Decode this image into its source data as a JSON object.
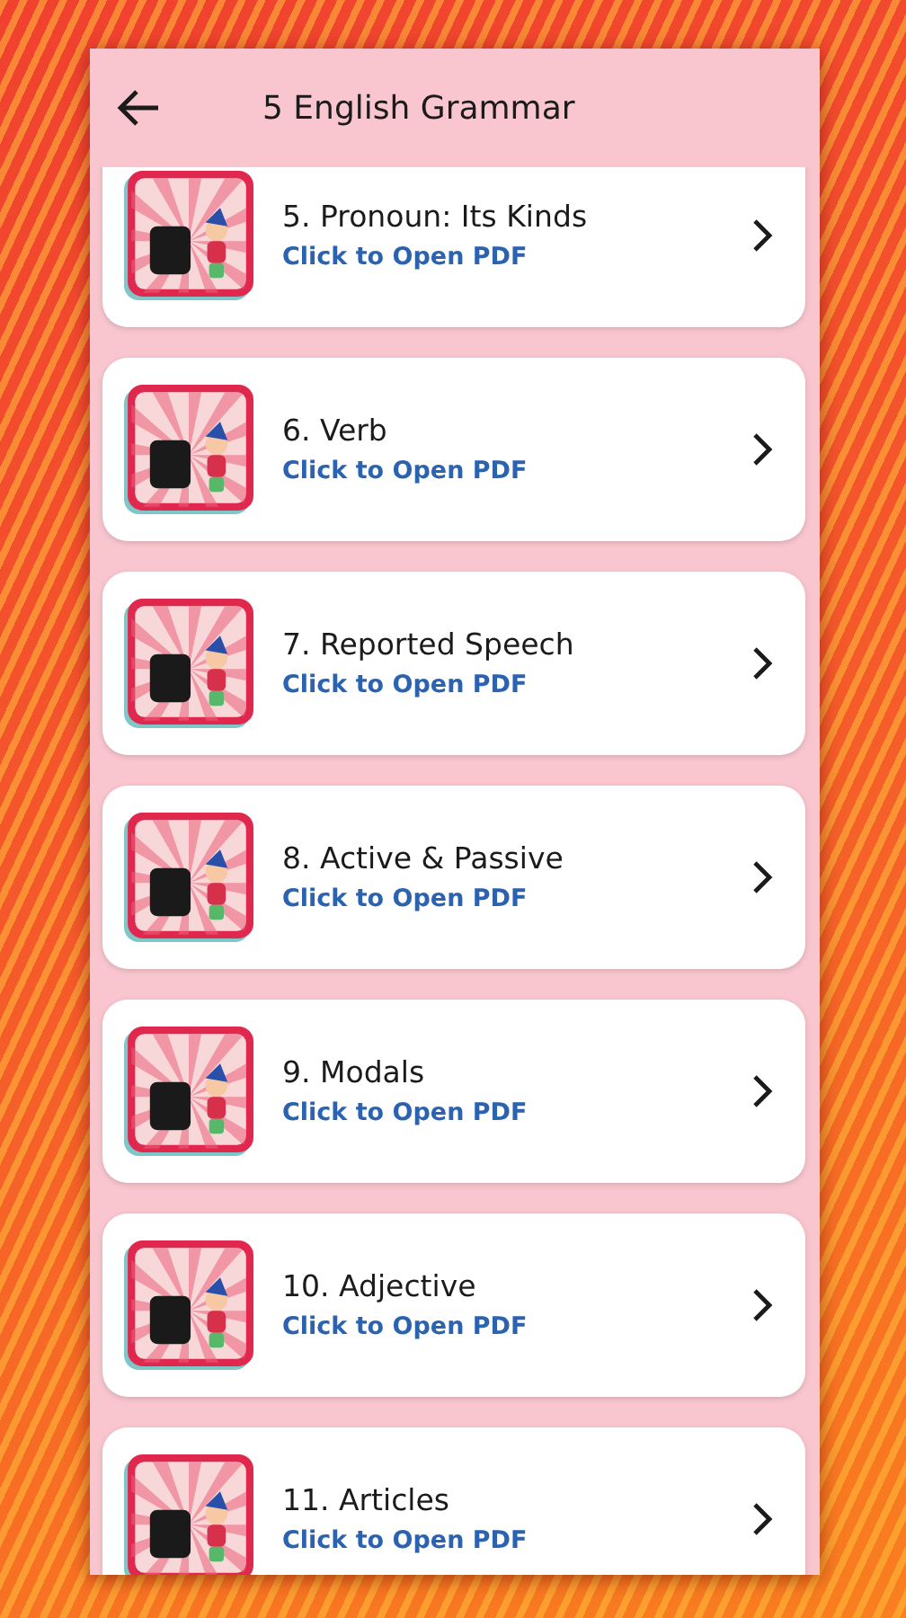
{
  "header": {
    "title": "5 English Grammar"
  },
  "items": [
    {
      "title": "5. Pronoun: Its Kinds",
      "subtitle": "Click to Open PDF"
    },
    {
      "title": "6. Verb",
      "subtitle": "Click to Open PDF"
    },
    {
      "title": "7. Reported Speech",
      "subtitle": "Click to Open PDF"
    },
    {
      "title": "8. Active & Passive",
      "subtitle": "Click to Open PDF"
    },
    {
      "title": "9. Modals",
      "subtitle": "Click to Open PDF"
    },
    {
      "title": "10. Adjective",
      "subtitle": "Click to Open PDF"
    },
    {
      "title": "11. Articles",
      "subtitle": "Click to Open PDF"
    }
  ]
}
